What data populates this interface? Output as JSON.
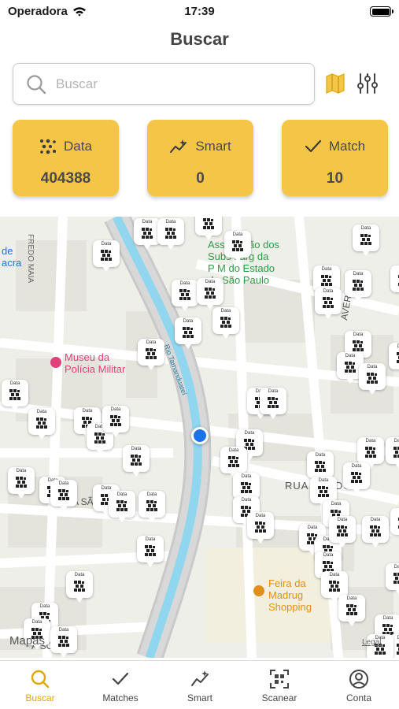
{
  "status": {
    "carrier": "Operadora",
    "time": "17:39"
  },
  "header": {
    "title": "Buscar"
  },
  "search": {
    "placeholder": "Buscar"
  },
  "cards": [
    {
      "label": "Data",
      "value": "404388",
      "icon": "dots-icon"
    },
    {
      "label": "Smart",
      "value": "0",
      "icon": "sparkle-graph-icon"
    },
    {
      "label": "Match",
      "value": "10",
      "icon": "checkmark-icon"
    }
  ],
  "map": {
    "labels": {
      "street_fredo_maia": "FREDO MAIA",
      "de_acra": "de\nacra",
      "assoc": "Associação dos\nSubs Larg da\nP M do Estado\nde São Paulo",
      "river": "Rio Tamanduateí",
      "museu": "Museu da\nPolícia Militar",
      "rua_teodo": "RUA   TEODO",
      "av_sa": "A SÃ",
      "aver": "AVER",
      "feira": "Feira da\nMadrug\nShopping",
      "sousa": "A SOUSA",
      "pin_label": "Data"
    },
    "attribution": "Mapas",
    "legal": "Legal"
  },
  "tabs": [
    {
      "label": "Buscar",
      "icon": "search-icon",
      "active": true
    },
    {
      "label": "Matches",
      "icon": "checkmark-icon",
      "active": false
    },
    {
      "label": "Smart",
      "icon": "sparkle-graph-icon",
      "active": false
    },
    {
      "label": "Scanear",
      "icon": "qr-scan-icon",
      "active": false
    },
    {
      "label": "Conta",
      "icon": "person-circle-icon",
      "active": false
    }
  ],
  "colors": {
    "accent": "#f4c546",
    "active_tab": "#e0a800",
    "river": "#8fd6ee",
    "location": "#1a73e8",
    "poi_green": "#2e9b47",
    "poi_pink": "#e2407a",
    "poi_orange": "#e0901a"
  }
}
